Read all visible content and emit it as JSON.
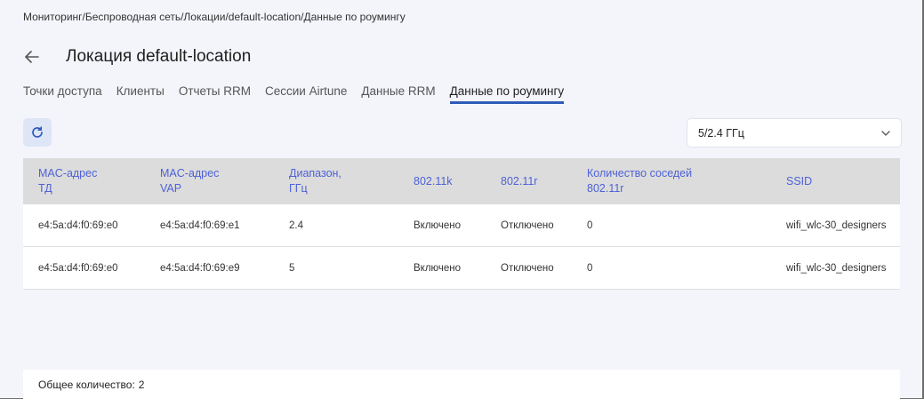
{
  "breadcrumb": "Мониторинг/Беспроводная сеть/Локации/default-location/Данные по роумингу",
  "page": {
    "title": "Локация default-location"
  },
  "tabs": [
    {
      "label": "Точки доступа",
      "active": false
    },
    {
      "label": "Клиенты",
      "active": false
    },
    {
      "label": "Отчеты RRM",
      "active": false
    },
    {
      "label": "Сессии Airtune",
      "active": false
    },
    {
      "label": "Данные RRM",
      "active": false
    },
    {
      "label": "Данные по роумингу",
      "active": true
    }
  ],
  "band_select": {
    "value": "5/2.4 ГГц"
  },
  "table": {
    "columns": [
      {
        "line1": "MAC-адрес",
        "line2": "ТД"
      },
      {
        "line1": "MAC-адрес",
        "line2": "VAP"
      },
      {
        "line1": "Диапазон,",
        "line2": "ГГц"
      },
      {
        "line1": "802.11k",
        "line2": ""
      },
      {
        "line1": "802.11r",
        "line2": ""
      },
      {
        "line1": "Количество соседей",
        "line2": "802.11r"
      },
      {
        "line1": "SSID",
        "line2": ""
      }
    ],
    "rows": [
      [
        "e4:5a:d4:f0:69:e0",
        "e4:5a:d4:f0:69:e1",
        "2.4",
        "Включено",
        "Отключено",
        "0",
        "wifi_wlc-30_designers"
      ],
      [
        "e4:5a:d4:f0:69:e0",
        "e4:5a:d4:f0:69:e9",
        "5",
        "Включено",
        "Отключено",
        "0",
        "wifi_wlc-30_designers"
      ]
    ]
  },
  "footer": {
    "total_label": "Общее количество:",
    "total_value": "2"
  },
  "colors": {
    "accent": "#4e62d6",
    "tab_underline": "#2e5bb8",
    "header_bg": "#dcdcdc",
    "page_bg": "#f4f5fb"
  },
  "icons": {
    "back": "arrow-left-icon",
    "refresh": "refresh-icon",
    "dropdown": "chevron-down-icon"
  }
}
